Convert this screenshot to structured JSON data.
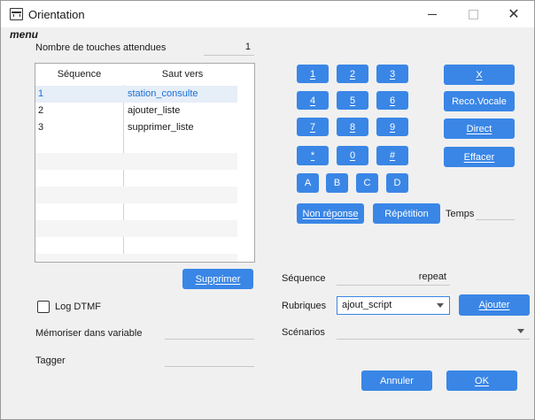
{
  "window": {
    "title": "Orientation"
  },
  "menu_label": "menu",
  "keys_expected": {
    "label": "Nombre de touches attendues",
    "value": "1"
  },
  "table": {
    "headers": [
      "Séquence",
      "Saut vers"
    ],
    "rows": [
      {
        "seq": "1",
        "target": "station_consulte"
      },
      {
        "seq": "2",
        "target": "ajouter_liste"
      },
      {
        "seq": "3",
        "target": "supprimer_liste"
      }
    ]
  },
  "keypad": {
    "keys": [
      "1",
      "2",
      "3",
      "4",
      "5",
      "6",
      "7",
      "8",
      "9",
      "*",
      "0",
      "#"
    ],
    "letters": [
      "A",
      "B",
      "C",
      "D"
    ]
  },
  "buttons": {
    "cancel_x": "X",
    "voice_reco": "Reco.Vocale",
    "direct": "Direct",
    "clear": "Effacer",
    "no_answer": "Non réponse",
    "repeat": "Répétition",
    "delete": "Supprimer",
    "add": "Ajouter",
    "cancel": "Annuler",
    "ok": "OK"
  },
  "temps": {
    "label": "Temps",
    "value": ""
  },
  "log_dtmf": {
    "label": "Log DTMF",
    "checked": false
  },
  "memorize": {
    "label": "Mémoriser dans variable",
    "value": ""
  },
  "tagger": {
    "label": "Tagger",
    "value": ""
  },
  "sequence_field": {
    "label": "Séquence",
    "value": "repeat"
  },
  "rubriques": {
    "label": "Rubriques",
    "value": "ajout_script"
  },
  "scenarios": {
    "label": "Scénarios",
    "value": ""
  },
  "colors": {
    "accent": "#3a86e6",
    "selected_text": "#1a6fd6"
  }
}
